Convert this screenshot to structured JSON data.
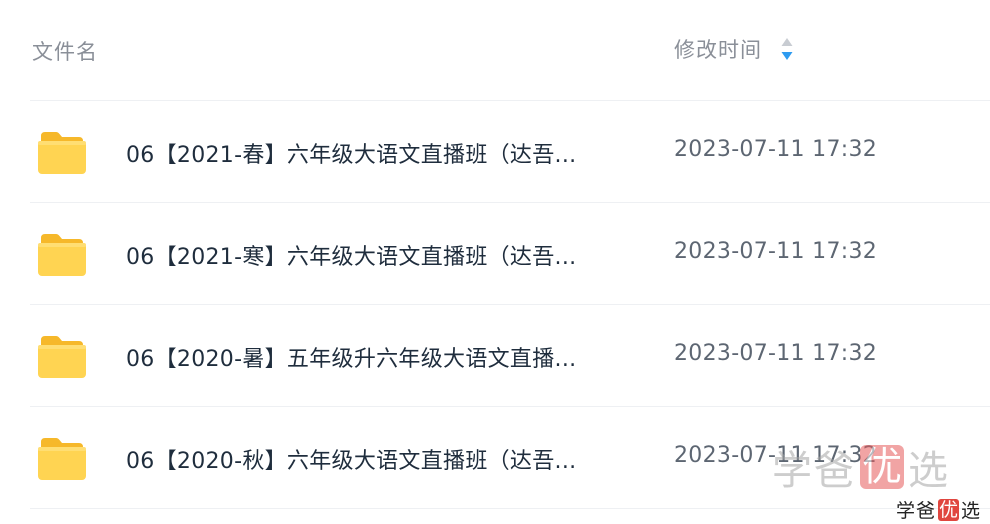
{
  "header": {
    "name_label": "文件名",
    "time_label": "修改时间",
    "sort_icon": "sort-icon"
  },
  "rows": [
    {
      "icon": "folder-icon",
      "name": "06【2021-春】六年级大语文直播班（达吾...",
      "time": "2023-07-11 17:32"
    },
    {
      "icon": "folder-icon",
      "name": "06【2021-寒】六年级大语文直播班（达吾...",
      "time": "2023-07-11 17:32"
    },
    {
      "icon": "folder-icon",
      "name": "06【2020-暑】五年级升六年级大语文直播...",
      "time": "2023-07-11 17:32"
    },
    {
      "icon": "folder-icon",
      "name": "06【2020-秋】六年级大语文直播班（达吾...",
      "time": "2023-07-11 17:32"
    }
  ],
  "watermark": {
    "text_a": "学爸",
    "badge": "优",
    "text_b": "选"
  },
  "colors": {
    "folder": "#FFD54F",
    "sort_active": "#2e9bf0",
    "divider": "#eef0f3"
  }
}
